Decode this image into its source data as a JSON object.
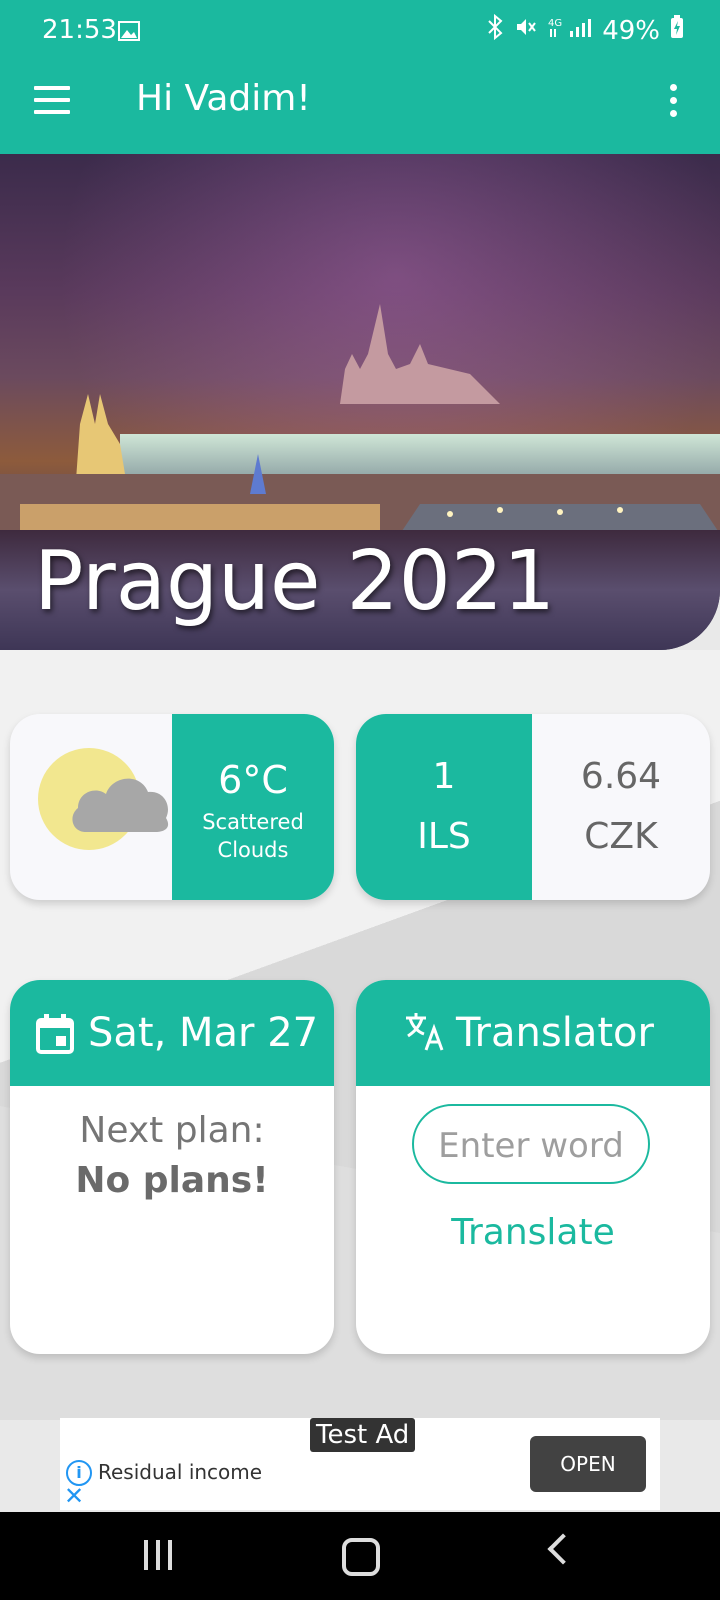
{
  "status_bar": {
    "time": "21:53",
    "battery": "49%"
  },
  "toolbar": {
    "title": "Hi Vadim!"
  },
  "hero": {
    "title": "Prague 2021"
  },
  "weather": {
    "temperature": "6°C",
    "description": "Scattered Clouds"
  },
  "currency": {
    "from_amount": "1",
    "from_code": "ILS",
    "to_amount": "6.64",
    "to_code": "CZK"
  },
  "date_card": {
    "date": "Sat, Mar 27",
    "next_plan_label": "Next plan:",
    "next_plan_value": "No plans!"
  },
  "translator": {
    "title": "Translator",
    "input_placeholder": "Enter word",
    "button": "Translate"
  },
  "ad": {
    "tag": "Test Ad",
    "text": "Residual income",
    "button": "OPEN"
  },
  "colors": {
    "primary": "#1bb99f"
  },
  "icons": [
    "menu-icon",
    "more-vert-icon",
    "calendar-icon",
    "translate-icon",
    "info-icon",
    "close-icon"
  ]
}
